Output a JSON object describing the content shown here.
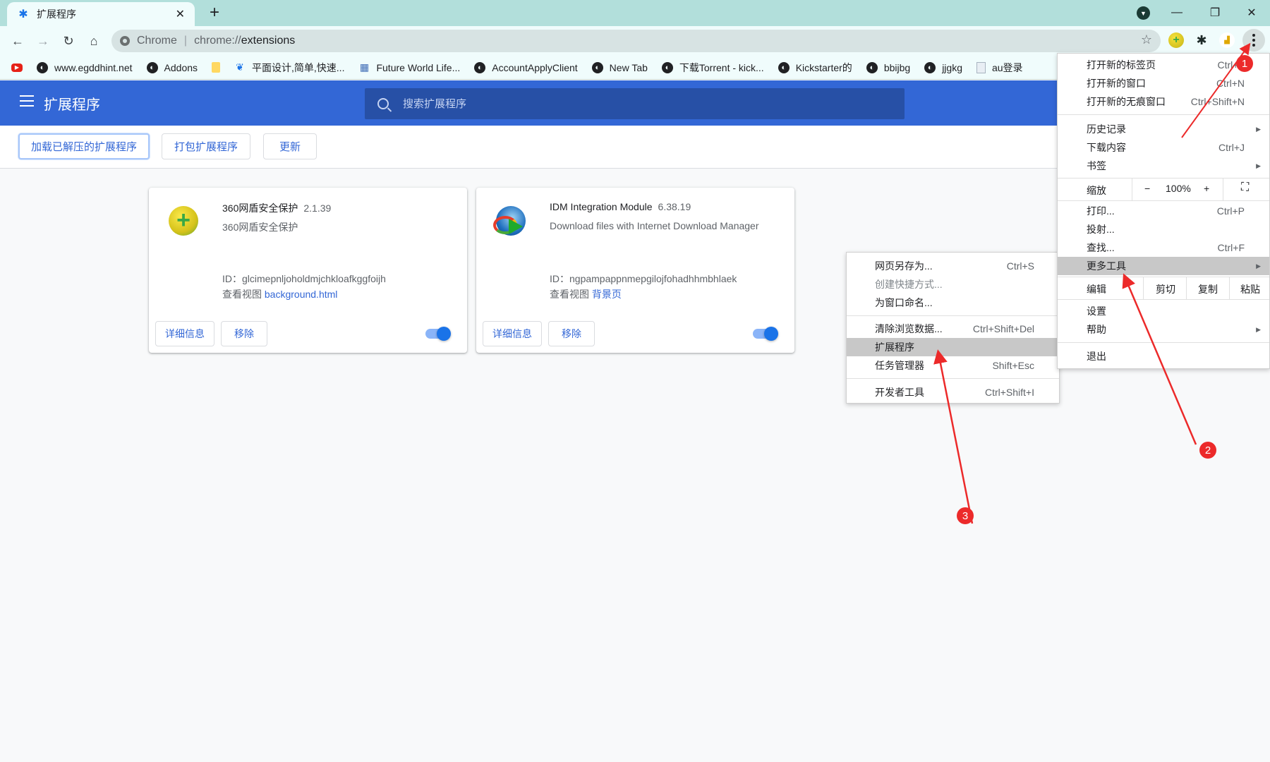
{
  "browser": {
    "tab": {
      "title": "扩展程序",
      "icon": "puzzle-icon"
    },
    "new_tab_label": "+",
    "window_controls": {
      "minimize": "—",
      "restore": "❐",
      "close": "✕"
    },
    "omnibox": {
      "chip": "Chrome",
      "url_scheme": "chrome://",
      "url_host": "extensions"
    },
    "toolbar_extensions": [
      "360-shield-icon",
      "puzzle-icon",
      "chart-extension-icon"
    ],
    "bookmarks": [
      {
        "label": "",
        "icon": "youtube-icon"
      },
      {
        "label": "www.egddhint.net",
        "icon": "globe-icon"
      },
      {
        "label": "Addons",
        "icon": "globe-icon"
      },
      {
        "label": "",
        "icon": "folder-icon"
      },
      {
        "label": "平面设计,简单,快速...",
        "icon": "leaf-icon"
      },
      {
        "label": "Future World Life...",
        "icon": "grid-icon"
      },
      {
        "label": "AccountApplyClient",
        "icon": "globe-icon"
      },
      {
        "label": "New Tab",
        "icon": "globe-icon"
      },
      {
        "label": "下载Torrent - kick...",
        "icon": "globe-icon"
      },
      {
        "label": "Kickstarter的",
        "icon": "globe-icon"
      },
      {
        "label": "bbijbg",
        "icon": "globe-icon"
      },
      {
        "label": "jjgkg",
        "icon": "globe-icon"
      },
      {
        "label": "au登录",
        "icon": "document-icon"
      }
    ]
  },
  "page": {
    "title": "扩展程序",
    "search_placeholder": "搜索扩展程序",
    "actions": {
      "load_unpacked": "加载已解压的扩展程序",
      "pack": "打包扩展程序",
      "update": "更新"
    },
    "extensions": [
      {
        "name": "360网盾安全保护",
        "version": "2.1.39",
        "description": "360网盾安全保护",
        "id_label": "ID：",
        "id": "glcimepnljoholdmjchkloafkggfoijh",
        "views_label": "查看视图",
        "view_link": "background.html",
        "details_label": "详细信息",
        "remove_label": "移除",
        "enabled": true
      },
      {
        "name": "IDM Integration Module",
        "version": "6.38.19",
        "description": "Download files with Internet Download Manager",
        "id_label": "ID：",
        "id": "ngpampappnmepgilojfohadhhmbhlaek",
        "views_label": "查看视图",
        "view_link": "背景页",
        "details_label": "详细信息",
        "remove_label": "移除",
        "enabled": true
      }
    ]
  },
  "main_menu": {
    "items": [
      {
        "label": "打开新的标签页",
        "shortcut": "Ctrl+T"
      },
      {
        "label": "打开新的窗口",
        "shortcut": "Ctrl+N"
      },
      {
        "label": "打开新的无痕窗口",
        "shortcut": "Ctrl+Shift+N"
      },
      {
        "label": "历史记录",
        "submenu": true
      },
      {
        "label": "下载内容",
        "shortcut": "Ctrl+J"
      },
      {
        "label": "书签",
        "submenu": true
      },
      {
        "label": "打印...",
        "shortcut": "Ctrl+P"
      },
      {
        "label": "投射..."
      },
      {
        "label": "查找...",
        "shortcut": "Ctrl+F"
      },
      {
        "label": "更多工具",
        "submenu": true,
        "highlighted": true
      },
      {
        "label": "设置"
      },
      {
        "label": "帮助",
        "submenu": true
      },
      {
        "label": "退出"
      }
    ],
    "zoom": {
      "label": "缩放",
      "minus": "−",
      "value": "100%",
      "plus": "+",
      "fullscreen": "⛶"
    },
    "edit": {
      "label": "编辑",
      "cut": "剪切",
      "copy": "复制",
      "paste": "粘贴"
    },
    "submenu_arrow": "▶"
  },
  "more_tools_menu": {
    "items": [
      {
        "label": "网页另存为...",
        "shortcut": "Ctrl+S"
      },
      {
        "label": "创建快捷方式...",
        "disabled": true
      },
      {
        "label": "为窗口命名..."
      },
      {
        "label": "清除浏览数据...",
        "shortcut": "Ctrl+Shift+Del"
      },
      {
        "label": "扩展程序",
        "highlighted": true
      },
      {
        "label": "任务管理器",
        "shortcut": "Shift+Esc"
      },
      {
        "label": "开发者工具",
        "shortcut": "Ctrl+Shift+I"
      }
    ]
  },
  "annotations": {
    "color": "#ec2a2a",
    "steps": [
      "1",
      "2",
      "3"
    ]
  },
  "colors": {
    "tabstrip": "#b2dfdb",
    "header": "#3367d6",
    "accent": "#1a73e8"
  }
}
